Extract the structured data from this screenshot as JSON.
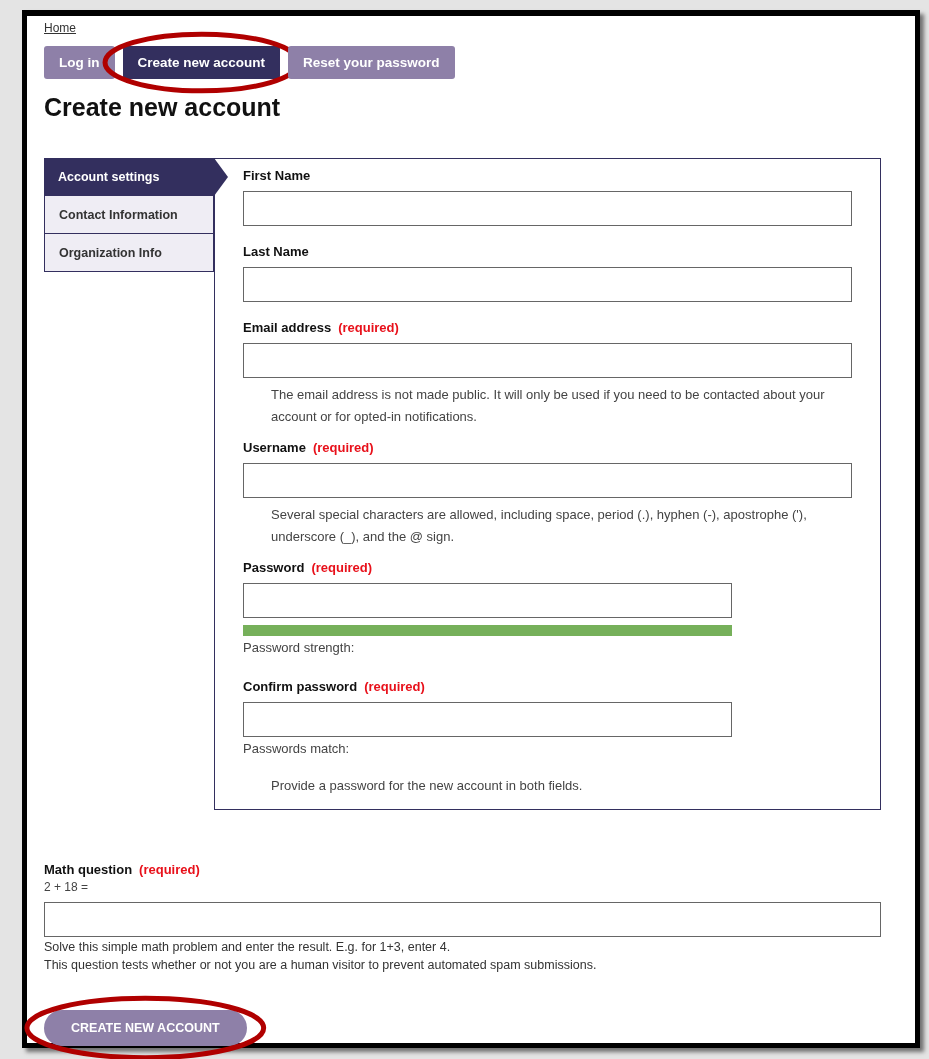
{
  "breadcrumb": {
    "label": "Home"
  },
  "tabs": [
    {
      "label": "Log in",
      "selected": false,
      "circled": false
    },
    {
      "label": "Create new account",
      "selected": true,
      "circled": true
    },
    {
      "label": "Reset your password",
      "selected": false,
      "circled": false
    }
  ],
  "title": "Create new account",
  "sections": [
    {
      "label": "Account settings",
      "selected": true
    },
    {
      "label": "Contact Information",
      "selected": false
    },
    {
      "label": "Organization Info",
      "selected": false
    }
  ],
  "fields": [
    {
      "kind": "text",
      "label": "First Name"
    },
    {
      "kind": "text",
      "label": "Last Name"
    },
    {
      "kind": "text",
      "label": "Email address",
      "required_note": "(required)",
      "description": "The email address is not made public. It will only be used if you need to be contacted about your account or for opted-in notifications."
    },
    {
      "kind": "text",
      "label": "Username",
      "required_note": "(required)",
      "description": "Several special characters are allowed, including space, period (.), hyphen (-), apostrophe ('), underscore (_), and the @ sign."
    },
    {
      "kind": "password",
      "label": "Password",
      "required_note": "(required)",
      "strength": {
        "level": 1,
        "color": "#76b05a"
      },
      "status": "Password strength:"
    },
    {
      "kind": "password",
      "label": "Confirm password",
      "required_note": "(required)",
      "status": "Passwords match:"
    }
  ],
  "password_description": "Provide a password for the new account in both fields.",
  "math": {
    "label": "Math question",
    "required_note": "(required)",
    "question": "2 + 18 =",
    "help": [
      "Solve this simple math problem and enter the result. E.g. for 1+3, enter 4.",
      "This question tests whether or not you are a human visitor to prevent automated spam submissions."
    ]
  },
  "submit": {
    "label": "CREATE NEW ACCOUNT",
    "circled": true
  }
}
